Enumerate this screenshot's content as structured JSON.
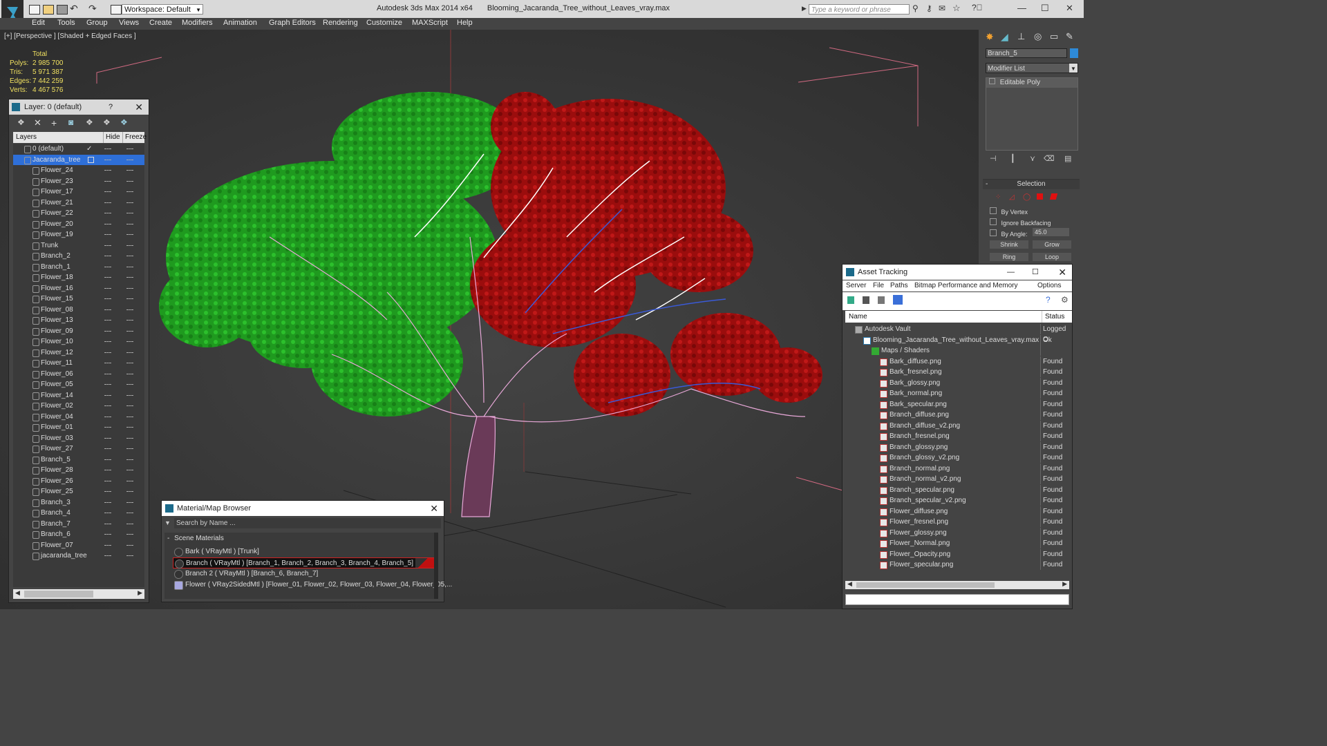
{
  "app": {
    "title": "Autodesk 3ds Max  2014 x64",
    "filename": "Blooming_Jacaranda_Tree_without_Leaves_vray.max",
    "workspace": "Workspace: Default",
    "search_placeholder": "Type a keyword or phrase"
  },
  "menu": [
    "Edit",
    "Tools",
    "Group",
    "Views",
    "Create",
    "Modifiers",
    "Animation",
    "Graph Editors",
    "Rendering",
    "Customize",
    "MAXScript",
    "Help"
  ],
  "viewport": {
    "label": "[+] [Perspective ] [Shaded + Edged Faces ]",
    "stats_header": "Total",
    "stats": [
      {
        "k": "Polys:",
        "v": "2 985 700"
      },
      {
        "k": "Tris:",
        "v": "5 971 387"
      },
      {
        "k": "Edges:",
        "v": "7 442 259"
      },
      {
        "k": "Verts:",
        "v": "4 467 576"
      }
    ]
  },
  "layer_panel": {
    "title": "Layer: 0 (default)",
    "help": "?",
    "col_layers": "Layers",
    "col_hide": "Hide",
    "col_freeze": "Freeze",
    "rows": [
      "0 (default)",
      "Jacaranda_tree",
      "Flower_24",
      "Flower_23",
      "Flower_17",
      "Flower_21",
      "Flower_22",
      "Flower_20",
      "Flower_19",
      "Trunk",
      "Branch_2",
      "Branch_1",
      "Flower_18",
      "Flower_16",
      "Flower_15",
      "Flower_08",
      "Flower_13",
      "Flower_09",
      "Flower_10",
      "Flower_12",
      "Flower_11",
      "Flower_06",
      "Flower_05",
      "Flower_14",
      "Flower_02",
      "Flower_04",
      "Flower_01",
      "Flower_03",
      "Flower_27",
      "Branch_5",
      "Flower_28",
      "Flower_26",
      "Flower_25",
      "Branch_3",
      "Branch_4",
      "Branch_7",
      "Branch_6",
      "Flower_07",
      "jacaranda_tree"
    ]
  },
  "command_panel": {
    "object_name": "Branch_5",
    "modifier_list": "Modifier List",
    "stack_item": "Editable Poly",
    "selection_header": "Selection",
    "by_vertex": "By Vertex",
    "ignore_backfacing": "Ignore Backfacing",
    "by_angle": "By Angle:",
    "angle_value": "45.0",
    "shrink": "Shrink",
    "grow": "Grow",
    "ring": "Ring",
    "loop": "Loop"
  },
  "asset_tracking": {
    "title": "Asset Tracking",
    "menu": [
      "Server",
      "File",
      "Paths",
      "Bitmap Performance and Memory",
      "Options"
    ],
    "col_name": "Name",
    "col_status": "Status",
    "rows": [
      {
        "name": "Autodesk Vault",
        "status": "Logged O",
        "indent": 1,
        "kind": "vault"
      },
      {
        "name": "Blooming_Jacaranda_Tree_without_Leaves_vray.max",
        "status": "Ok",
        "indent": 2,
        "kind": "max"
      },
      {
        "name": "Maps / Shaders",
        "status": "",
        "indent": 3,
        "kind": "folder"
      },
      {
        "name": "Bark_diffuse.png",
        "status": "Found",
        "indent": 4,
        "kind": "png"
      },
      {
        "name": "Bark_fresnel.png",
        "status": "Found",
        "indent": 4,
        "kind": "png"
      },
      {
        "name": "Bark_glossy.png",
        "status": "Found",
        "indent": 4,
        "kind": "png"
      },
      {
        "name": "Bark_normal.png",
        "status": "Found",
        "indent": 4,
        "kind": "png"
      },
      {
        "name": "Bark_specular.png",
        "status": "Found",
        "indent": 4,
        "kind": "png"
      },
      {
        "name": "Branch_diffuse.png",
        "status": "Found",
        "indent": 4,
        "kind": "png"
      },
      {
        "name": "Branch_diffuse_v2.png",
        "status": "Found",
        "indent": 4,
        "kind": "png"
      },
      {
        "name": "Branch_fresnel.png",
        "status": "Found",
        "indent": 4,
        "kind": "png"
      },
      {
        "name": "Branch_glossy.png",
        "status": "Found",
        "indent": 4,
        "kind": "png"
      },
      {
        "name": "Branch_glossy_v2.png",
        "status": "Found",
        "indent": 4,
        "kind": "png"
      },
      {
        "name": "Branch_normal.png",
        "status": "Found",
        "indent": 4,
        "kind": "png"
      },
      {
        "name": "Branch_normal_v2.png",
        "status": "Found",
        "indent": 4,
        "kind": "png"
      },
      {
        "name": "Branch_specular.png",
        "status": "Found",
        "indent": 4,
        "kind": "png"
      },
      {
        "name": "Branch_specular_v2.png",
        "status": "Found",
        "indent": 4,
        "kind": "png"
      },
      {
        "name": "Flower_diffuse.png",
        "status": "Found",
        "indent": 4,
        "kind": "png"
      },
      {
        "name": "Flower_fresnel.png",
        "status": "Found",
        "indent": 4,
        "kind": "png"
      },
      {
        "name": "Flower_glossy.png",
        "status": "Found",
        "indent": 4,
        "kind": "png"
      },
      {
        "name": "Flower_Normal.png",
        "status": "Found",
        "indent": 4,
        "kind": "png"
      },
      {
        "name": "Flower_Opacity.png",
        "status": "Found",
        "indent": 4,
        "kind": "png"
      },
      {
        "name": "Flower_specular.png",
        "status": "Found",
        "indent": 4,
        "kind": "png"
      }
    ]
  },
  "material_browser": {
    "title": "Material/Map Browser",
    "search_placeholder": "Search by Name ...",
    "section": "Scene Materials",
    "items": [
      "Bark  ( VRayMtl )  [Trunk]",
      "Branch  ( VRayMtl )  [Branch_1, Branch_2, Branch_3, Branch_4, Branch_5]",
      "Branch 2  ( VRayMtl )  [Branch_6, Branch_7]",
      "Flower  ( VRay2SidedMtl )  [Flower_01, Flower_02, Flower_03, Flower_04, Flower_05,..."
    ]
  },
  "colors": {
    "viewport_bg": "#3b3b3b",
    "selection_blue": "#2e6fd8",
    "flower_green": "#1fa31f",
    "flower_red": "#a30f0f"
  }
}
